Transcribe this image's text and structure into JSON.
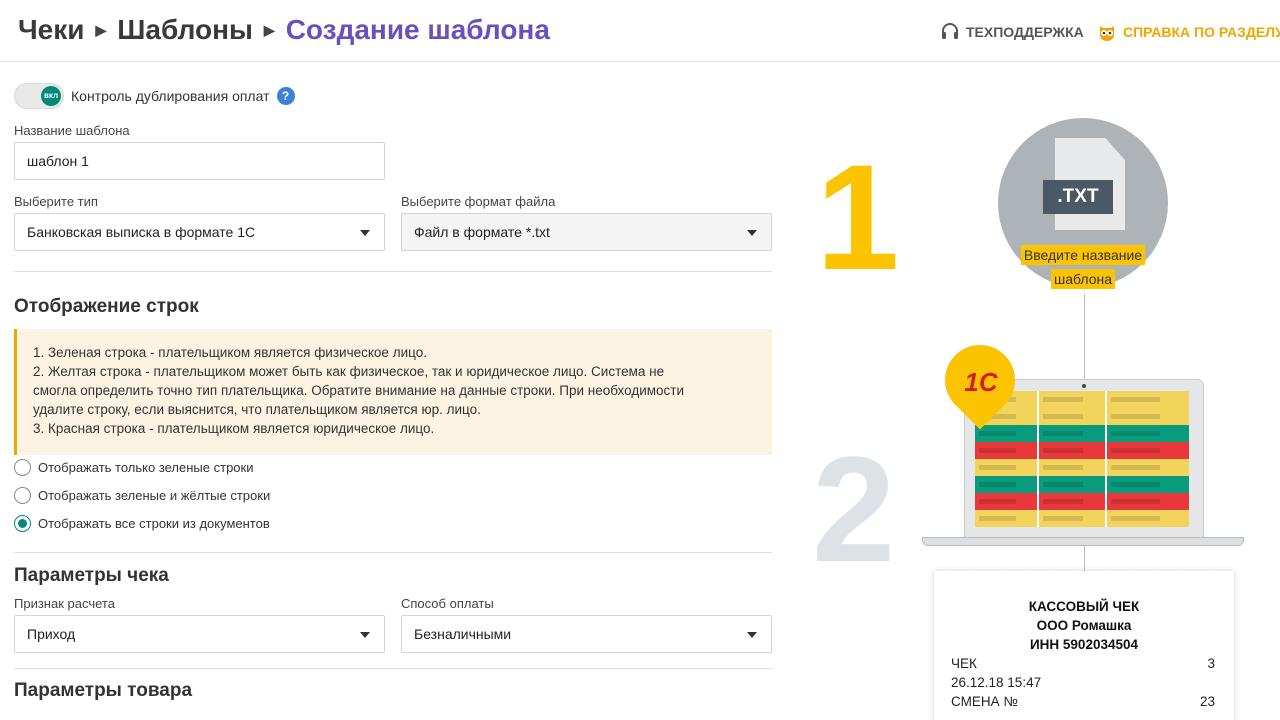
{
  "header": {
    "crumbs": [
      "Чеки",
      "Шаблоны",
      "Создание шаблона"
    ],
    "support_label": "ТЕХПОДДЕРЖКА",
    "help_label": "СПРАВКА ПО РАЗДЕЛУ"
  },
  "form": {
    "duplicate_control_label": "Контроль дублирования оплат",
    "toggle_text": "вкл",
    "template_name_label": "Название шаблона",
    "template_name_value": "шаблон 1",
    "type_label": "Выберите тип",
    "type_value": "Банковская выписка в формате 1С",
    "format_label": "Выберите формат файла",
    "format_value": "Файл в формате *.txt",
    "rows_section_title": "Отображение строк",
    "notice_lines": [
      "1. Зеленая строка - плательщиком является физическое лицо.",
      "2. Желтая строка - плательщиком может быть как физическое, так и юридическое лицо. Система не",
      "смогла определить точно тип плательщика. Обратите внимание на данные строки. При необходимости",
      "удалите строку, если выяснится, что плательщиком является юр. лицо.",
      "3. Красная строка - плательщиком является юридическое лицо."
    ],
    "radio_options": [
      {
        "label": "Отображать только зеленые строки",
        "checked": false
      },
      {
        "label": "Отображать зеленые и жёлтые строки",
        "checked": false
      },
      {
        "label": "Отображать все строки из документов",
        "checked": true
      }
    ],
    "receipt_section_title": "Параметры чека",
    "calc_sign_label": "Признак расчета",
    "calc_sign_value": "Приход",
    "payment_method_label": "Способ оплаты",
    "payment_method_value": "Безналичными",
    "goods_section_title": "Параметры товара"
  },
  "illustration": {
    "step1": "1",
    "step2": "2",
    "file_ext": ".TXT",
    "name_tag_lines": [
      "Введите название",
      "шаблона"
    ],
    "logo_text": "1С",
    "receipt": {
      "title": "КАССОВЫЙ ЧЕК",
      "company": "ООО Ромашка",
      "inn": "ИНН 5902034504",
      "rows": [
        {
          "left": "ЧЕК",
          "right": "3"
        },
        {
          "left": "26.12.18 15:47",
          "right": ""
        },
        {
          "left": "СМЕНА №",
          "right": "23"
        }
      ]
    },
    "row_colors": [
      "#f2d35c",
      "#f2d35c",
      "#0a9a7c",
      "#e8383b",
      "#f2d35c",
      "#0a9a7c",
      "#e8383b",
      "#f2d35c"
    ]
  },
  "colors": {
    "accent_purple": "#6b4fbf",
    "accent_yellow": "#fcc400",
    "accent_green": "#00897b"
  }
}
